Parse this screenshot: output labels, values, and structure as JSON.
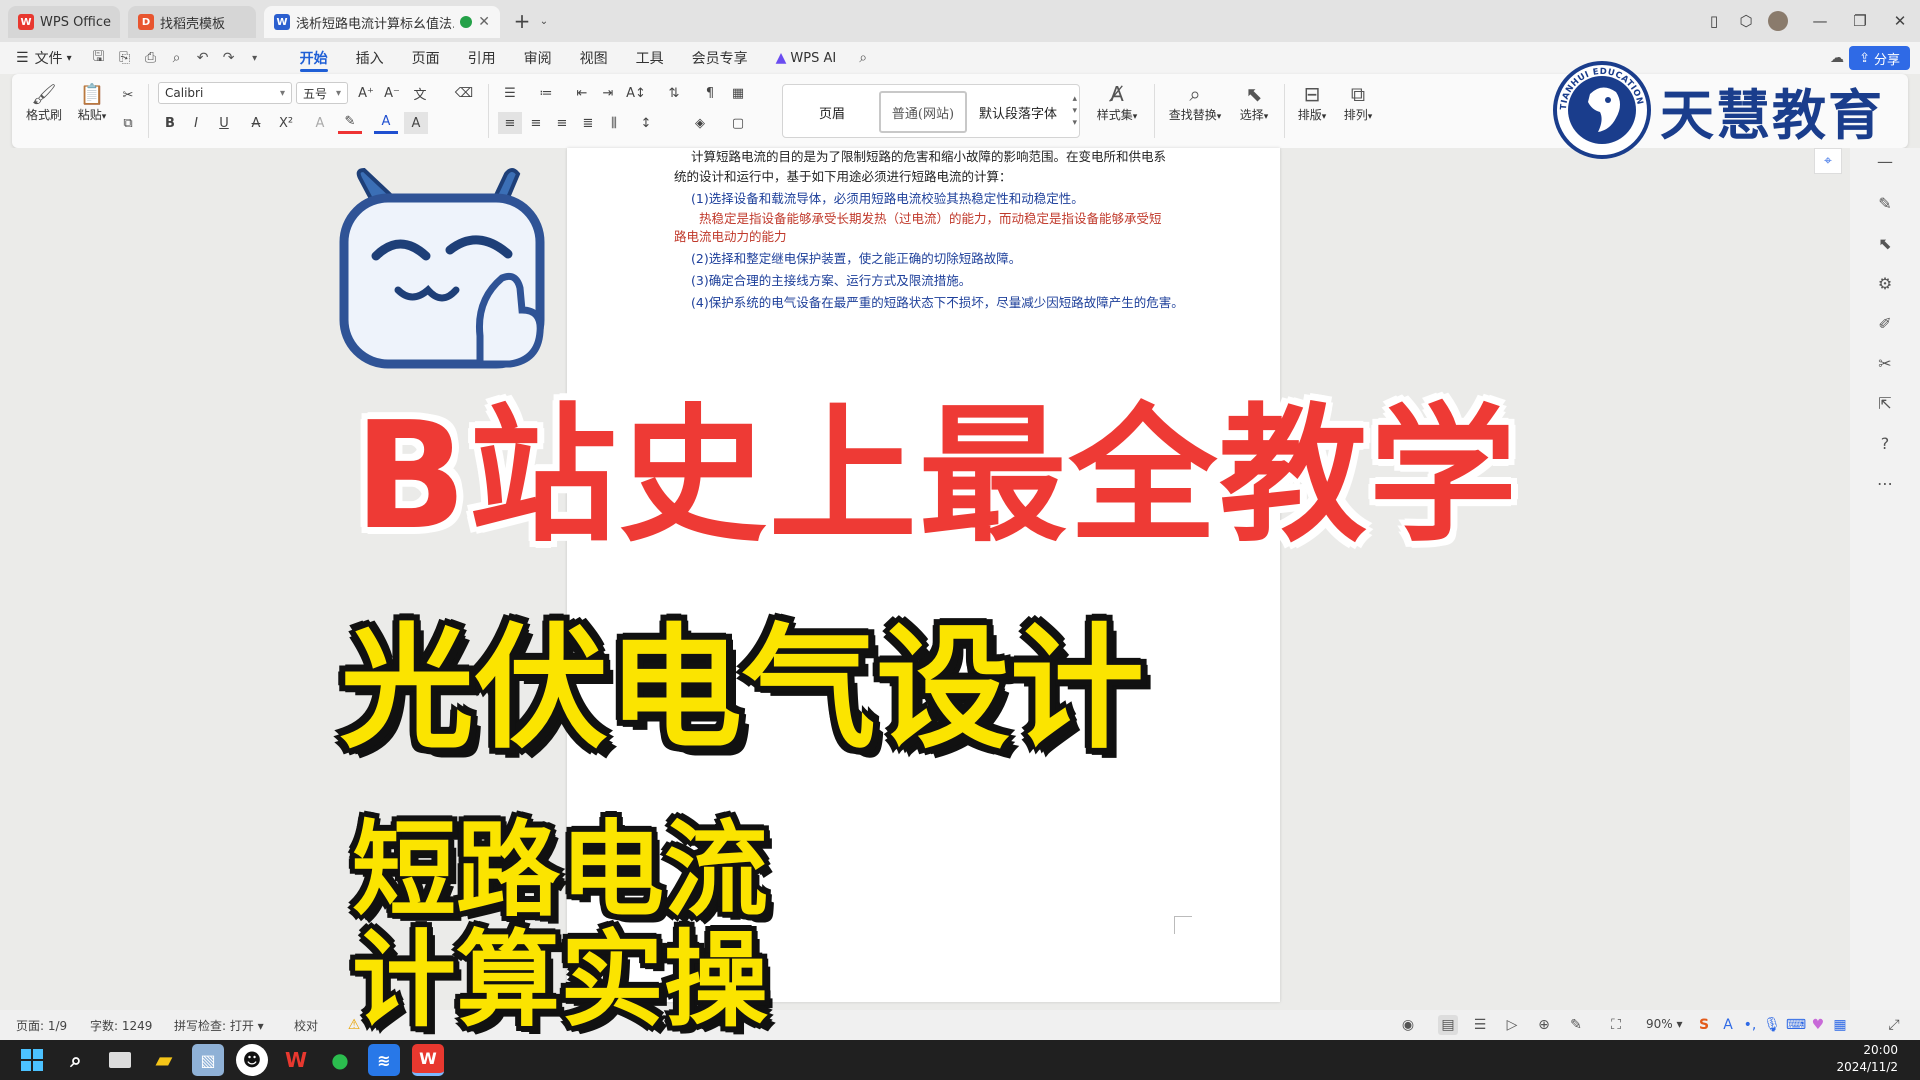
{
  "tabs": [
    {
      "label": "WPS Office",
      "icon": "wps-logo-icon",
      "active": false
    },
    {
      "label": "找稻壳模板",
      "icon": "docer-icon",
      "active": false
    },
    {
      "label": "浅析短路电流计算标幺值法.dc",
      "icon": "word-doc-icon",
      "active": true
    }
  ],
  "menu": {
    "file": "文件",
    "items": [
      "开始",
      "插入",
      "页面",
      "引用",
      "审阅",
      "视图",
      "工具",
      "会员专享"
    ],
    "active_index": 0,
    "wps_ai": "WPS AI",
    "share": "分享"
  },
  "ribbon": {
    "format_painter": "格式刷",
    "paste": "粘贴",
    "font_name": "Calibri",
    "font_size": "五号",
    "styles": [
      "页眉",
      "普通(网站)",
      "默认段落字体"
    ],
    "style_set": "样式集",
    "find_replace": "查找替换",
    "select": "选择",
    "layout": "排版",
    "arrange": "排列"
  },
  "document": {
    "lines": [
      {
        "text": "计算短路电流的目的是为了限制短路的危害和缩小故障的影响范围。在变电所和供电系",
        "color": "black"
      },
      {
        "text": "统的设计和运行中，基于如下用途必须进行短路电流的计算：",
        "color": "black"
      },
      {
        "text": "(1)选择设备和载流导体，必须用短路电流校验其热稳定性和动稳定性。",
        "color": "blue"
      },
      {
        "text": "热稳定是指设备能够承受长期发热（过电流）的能力，而动稳定是指设备能够承受短",
        "color": "red"
      },
      {
        "text": "路电流电动力的能力",
        "color": "red"
      },
      {
        "text": "(2)选择和整定继电保护装置，使之能正确的切除短路故障。",
        "color": "blue"
      },
      {
        "text": "(3)确定合理的主接线方案、运行方式及限流措施。",
        "color": "blue"
      },
      {
        "text": "(4)保护系统的电气设备在最严重的短路状态下不损坏，尽量减少因短路故障产生的危害。",
        "color": "blue"
      }
    ]
  },
  "status": {
    "page": "页面: 1/9",
    "words": "字数: 1249",
    "spell": "拼写检查: 打开",
    "proof": "校对",
    "zoom": "90%"
  },
  "overlay": {
    "headline": "B站史上最全教学",
    "title": "光伏电气设计",
    "sub1": "短路电流",
    "sub2": "计算实操",
    "brand": "天慧教育",
    "seal_text": "TIANHUI EDUCATION"
  },
  "clock": {
    "time": "20:00",
    "date": "2024/11/2"
  },
  "colors": {
    "accent": "#1f5fd6",
    "headline_red": "#ee3a35",
    "title_yellow": "#fbe400",
    "brand_blue": "#1a3d8c"
  }
}
